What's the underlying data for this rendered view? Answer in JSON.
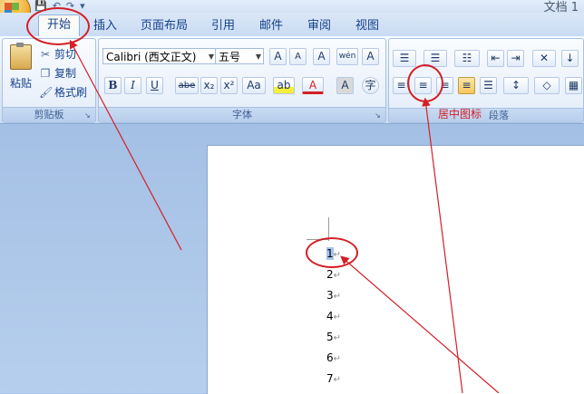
{
  "titlebar": {
    "doc_title": "文档 1",
    "qat": [
      "💾",
      "↶",
      "↷",
      "▾"
    ]
  },
  "tabs": [
    {
      "label": "开始",
      "active": true
    },
    {
      "label": "插入"
    },
    {
      "label": "页面布局"
    },
    {
      "label": "引用"
    },
    {
      "label": "邮件"
    },
    {
      "label": "审阅"
    },
    {
      "label": "视图"
    }
  ],
  "clipboard": {
    "paste_label": "粘贴",
    "cut_label": "剪切",
    "copy_label": "复制",
    "format_painter_label": "格式刷",
    "group_label": "剪贴板"
  },
  "font": {
    "font_name": "Calibri (西文正文)",
    "font_size": "五号",
    "group_label": "字体",
    "grow_label": "A",
    "shrink_label": "A",
    "clear_label": "A",
    "phonetic_label": "wén",
    "border_label": "A",
    "bold": "B",
    "italic": "I",
    "underline": "U",
    "strike": "abe",
    "subscript": "x₂",
    "superscript": "x²",
    "change_case": "Aa",
    "highlight": "ab",
    "font_color": "A",
    "shading": "A",
    "enclose": "字"
  },
  "paragraph": {
    "group_label": "段落",
    "center_annotation": "居中图标"
  },
  "document": {
    "lines": [
      "1",
      "2",
      "3",
      "4",
      "5",
      "6",
      "7"
    ],
    "paragraph_mark": "↵"
  },
  "colors": {
    "accent": "#15428b",
    "annotation": "#d41f26",
    "selection": "#a7c3ec"
  }
}
